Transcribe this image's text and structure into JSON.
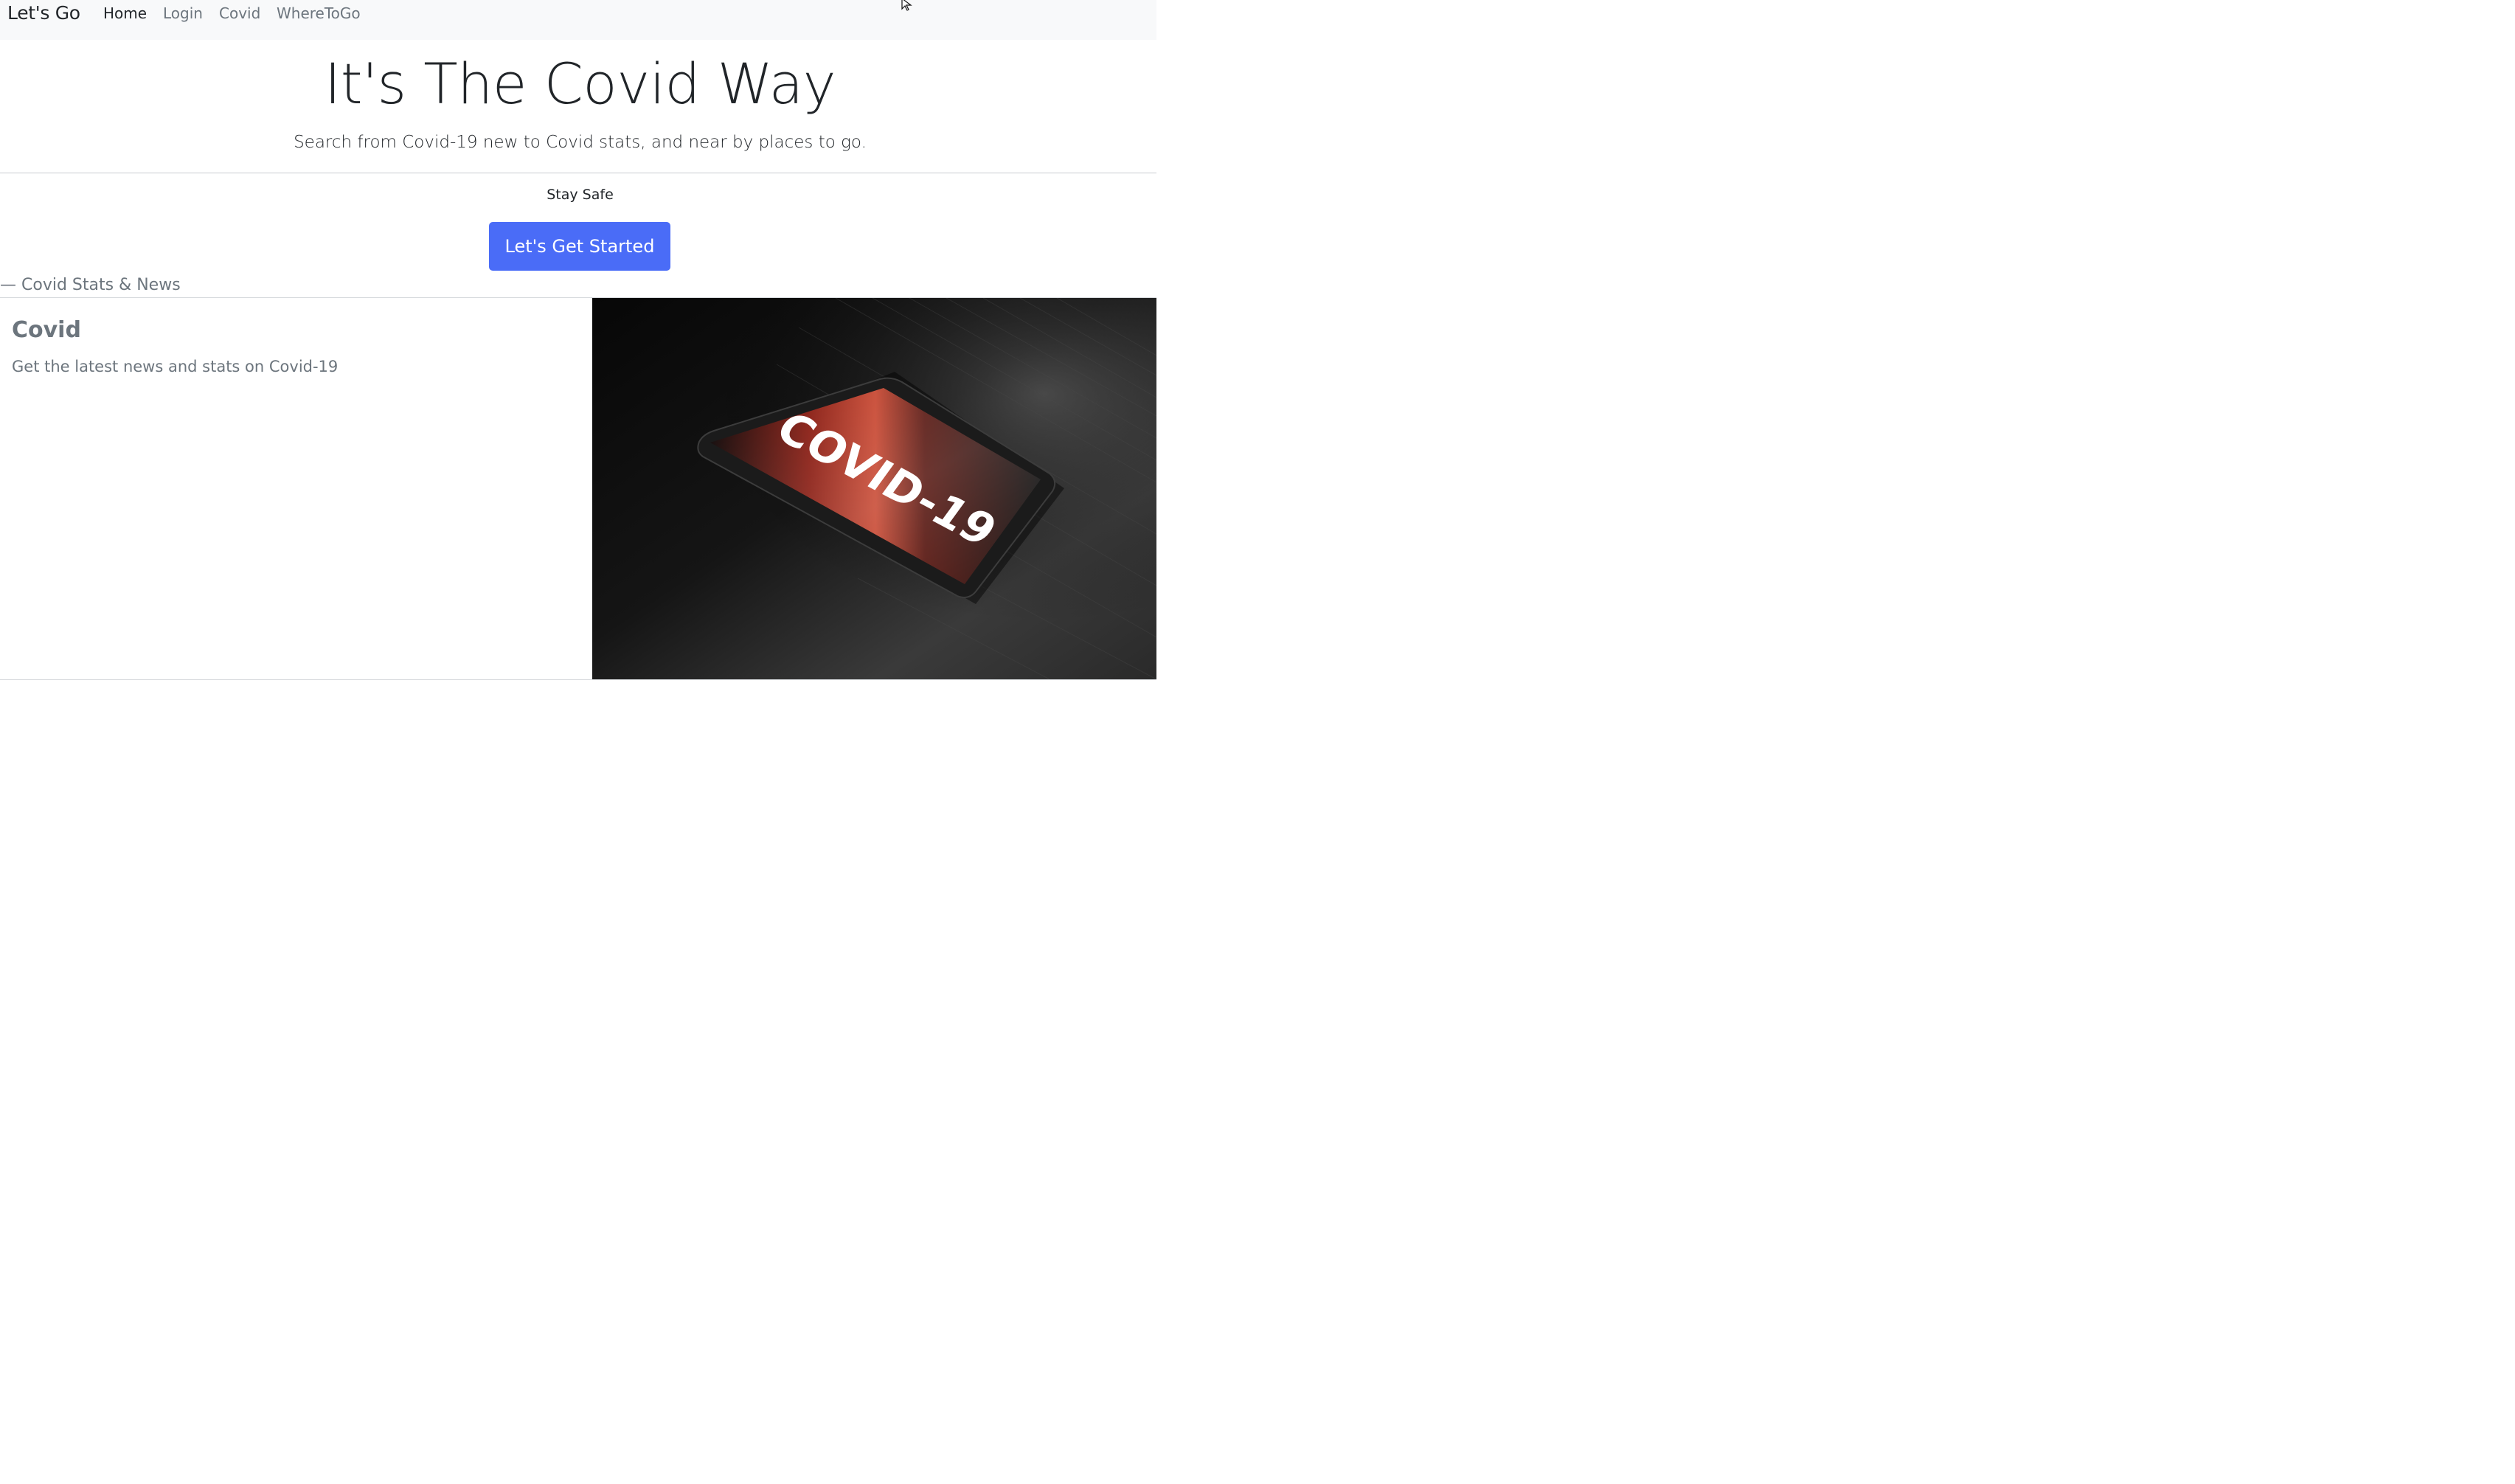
{
  "navbar": {
    "brand": "Let's Go",
    "links": [
      {
        "label": "Home",
        "active": true
      },
      {
        "label": "Login",
        "active": false
      },
      {
        "label": "Covid",
        "active": false
      },
      {
        "label": "WhereToGo",
        "active": false
      }
    ]
  },
  "hero": {
    "title": "It's The Covid Way",
    "lead": "Search from Covid-19 new to Covid stats, and near by places to go.",
    "note": "Stay Safe",
    "button_label": "Let's Get Started"
  },
  "section": {
    "label": "— Covid Stats & News"
  },
  "card": {
    "title": "Covid",
    "text": "Get the latest news and stats on Covid-19",
    "image_text": "COVID-19"
  },
  "colors": {
    "primary": "#4a6cf7",
    "navbar_bg": "#f8f9fa",
    "muted": "#6c757d",
    "dark": "#212529"
  }
}
